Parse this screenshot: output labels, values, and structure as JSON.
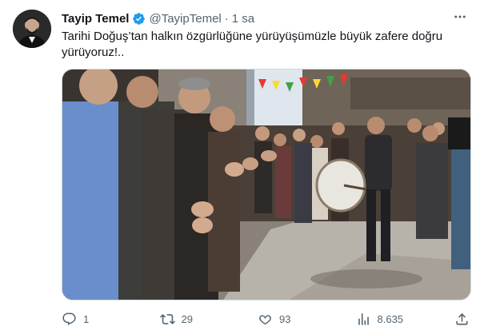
{
  "tweet": {
    "author_name": "Tayip Temel",
    "handle": "@TayipTemel",
    "separator": "·",
    "time": "1 sa",
    "text": "Tarihi Doğuş’tan halkın özgürlüğüne yürüyüşümüzle büyük zafere doğru yürüyoruz!..",
    "more_label": "•••"
  },
  "metrics": {
    "replies": "1",
    "retweets": "29",
    "likes": "93",
    "views": "8.635"
  },
  "icons": {
    "verified": "verified-badge-icon",
    "reply": "reply-icon",
    "retweet": "retweet-icon",
    "like": "heart-icon",
    "views": "views-bar-icon",
    "share": "share-icon",
    "more": "more-dots-icon"
  },
  "colors": {
    "verified": "#1d9bf0",
    "muted": "#536471",
    "text": "#0f1419"
  }
}
